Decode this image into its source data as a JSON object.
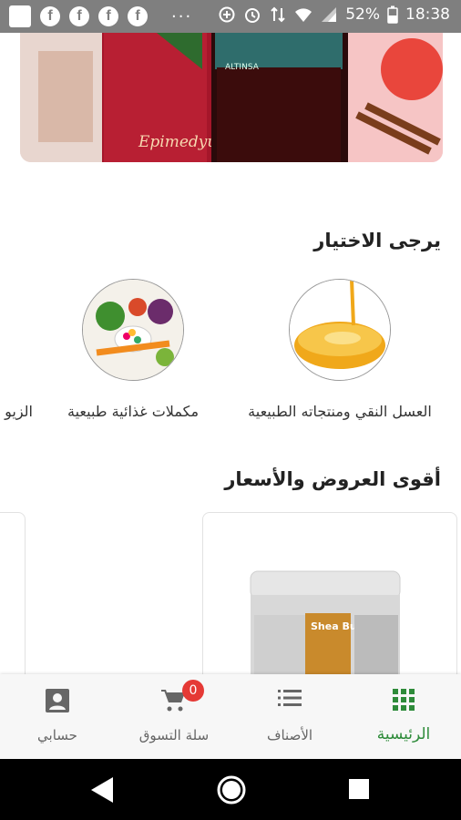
{
  "status_bar": {
    "battery": "52%",
    "time": "18:38",
    "fb_glyph": "f",
    "more_glyph": "···"
  },
  "banner": {
    "product_text": "Epimedyum",
    "jar_label": "ALTINSA"
  },
  "sections": {
    "choose_title": "يرجى الاختيار",
    "offers_title": "أقوى العروض والأسعار"
  },
  "categories": [
    {
      "label": "العسل النقي ومنتجاته الطبيعية",
      "icon": "honey-image"
    },
    {
      "label": "مكملات غذائية طبيعية",
      "icon": "vegetables-pills-image"
    },
    {
      "label": "الزيو",
      "icon": "oils-image"
    }
  ],
  "product_card": {
    "jar_title": "Shea Butter"
  },
  "bottom_nav": {
    "home": "الرئيسية",
    "categories": "الأصناف",
    "cart": "سلة التسوق",
    "cart_count": "0",
    "account": "حسابي"
  },
  "colors": {
    "accent": "#2e8b3a",
    "badge": "#e53935",
    "status_bar": "#7f7f7f"
  }
}
